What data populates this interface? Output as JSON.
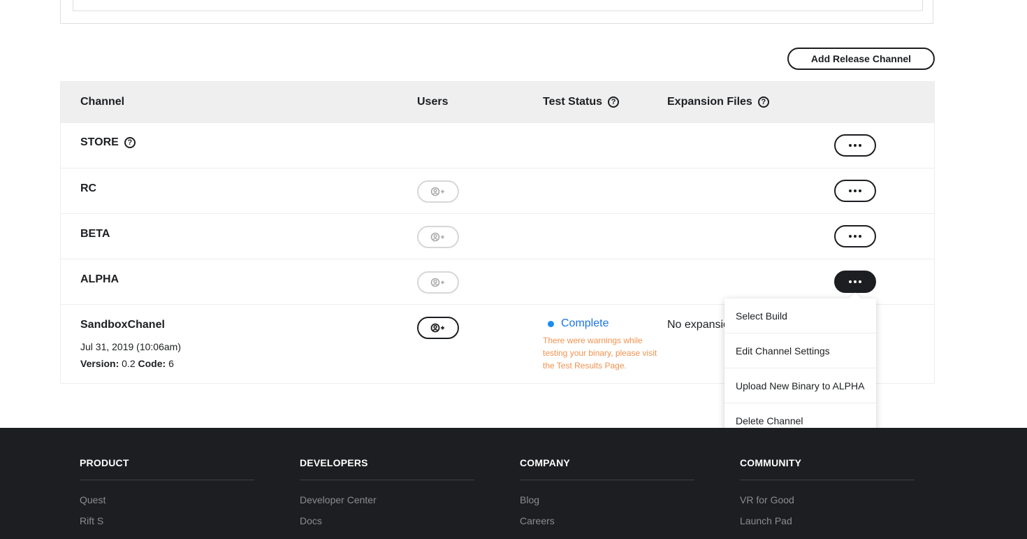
{
  "toolbar": {
    "add_channel_label": "Add Release Channel"
  },
  "table": {
    "headers": {
      "channel": "Channel",
      "users": "Users",
      "test_status": "Test Status",
      "expansion_files": "Expansion Files"
    },
    "rows": [
      {
        "name": "STORE"
      },
      {
        "name": "RC"
      },
      {
        "name": "BETA"
      },
      {
        "name": "ALPHA"
      },
      {
        "name": "SandboxChanel",
        "date": "Jul 31, 2019 (10:06am)",
        "version_label": "Version:",
        "version_value": "0.2",
        "code_label": "Code:",
        "code_value": "6",
        "status": "Complete",
        "status_warning": "There were warnings while testing your binary, please visit the Test Results Page.",
        "expansion": "No expansion files"
      }
    ]
  },
  "dropdown": {
    "items": [
      "Select Build",
      "Edit Channel Settings",
      "Upload New Binary to ALPHA",
      "Delete Channel"
    ]
  },
  "footer": {
    "columns": [
      {
        "heading": "PRODUCT",
        "links": [
          "Quest",
          "Rift S"
        ]
      },
      {
        "heading": "DEVELOPERS",
        "links": [
          "Developer Center",
          "Docs"
        ]
      },
      {
        "heading": "COMPANY",
        "links": [
          "Blog",
          "Careers"
        ]
      },
      {
        "heading": "COMMUNITY",
        "links": [
          "VR for Good",
          "Launch Pad"
        ]
      }
    ]
  },
  "colors": {
    "status_blue": "#1b74e4",
    "warning_orange": "#f0924f",
    "footer_bg": "#1c1e21"
  },
  "icons": {
    "help": "question-circle-icon",
    "add_user": "add-user-icon",
    "more": "ellipsis-icon"
  }
}
